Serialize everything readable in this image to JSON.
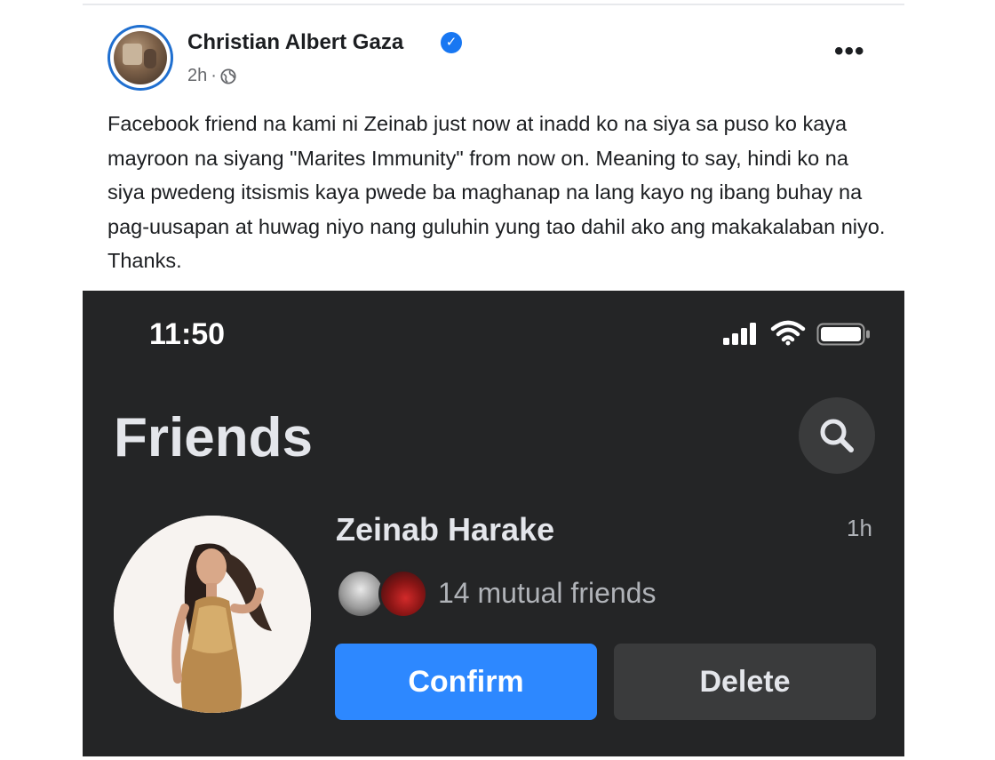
{
  "post": {
    "author": "Christian Albert Gaza",
    "timestamp": "2h",
    "audience_icon": "globe-icon",
    "verified_icon": "verified-badge-icon",
    "more_label": "•••",
    "text": "Facebook friend na kami ni Zeinab just now at inadd ko na siya sa puso ko kaya mayroon na siyang \"Marites Immunity\" from now on. Meaning to say, hindi ko na siya pwedeng itsismis kaya pwede ba maghanap na lang kayo ng ibang buhay na pag-uusapan at huwag niyo nang guluhin yung tao dahil ako ang makakalaban niyo. Thanks."
  },
  "screenshot": {
    "status_bar": {
      "time": "11:50",
      "icons": [
        "cellular-signal-icon",
        "wifi-icon",
        "battery-icon"
      ]
    },
    "header": {
      "title": "Friends",
      "search_icon": "search-icon"
    },
    "request": {
      "name": "Zeinab Harake",
      "time": "1h",
      "mutual_friends": "14 mutual friends",
      "confirm_label": "Confirm",
      "delete_label": "Delete"
    }
  },
  "colors": {
    "verified_blue": "#1877f2",
    "dark_bg": "#242526",
    "confirm_blue": "#2d88ff",
    "delete_gray": "#3a3b3c"
  }
}
